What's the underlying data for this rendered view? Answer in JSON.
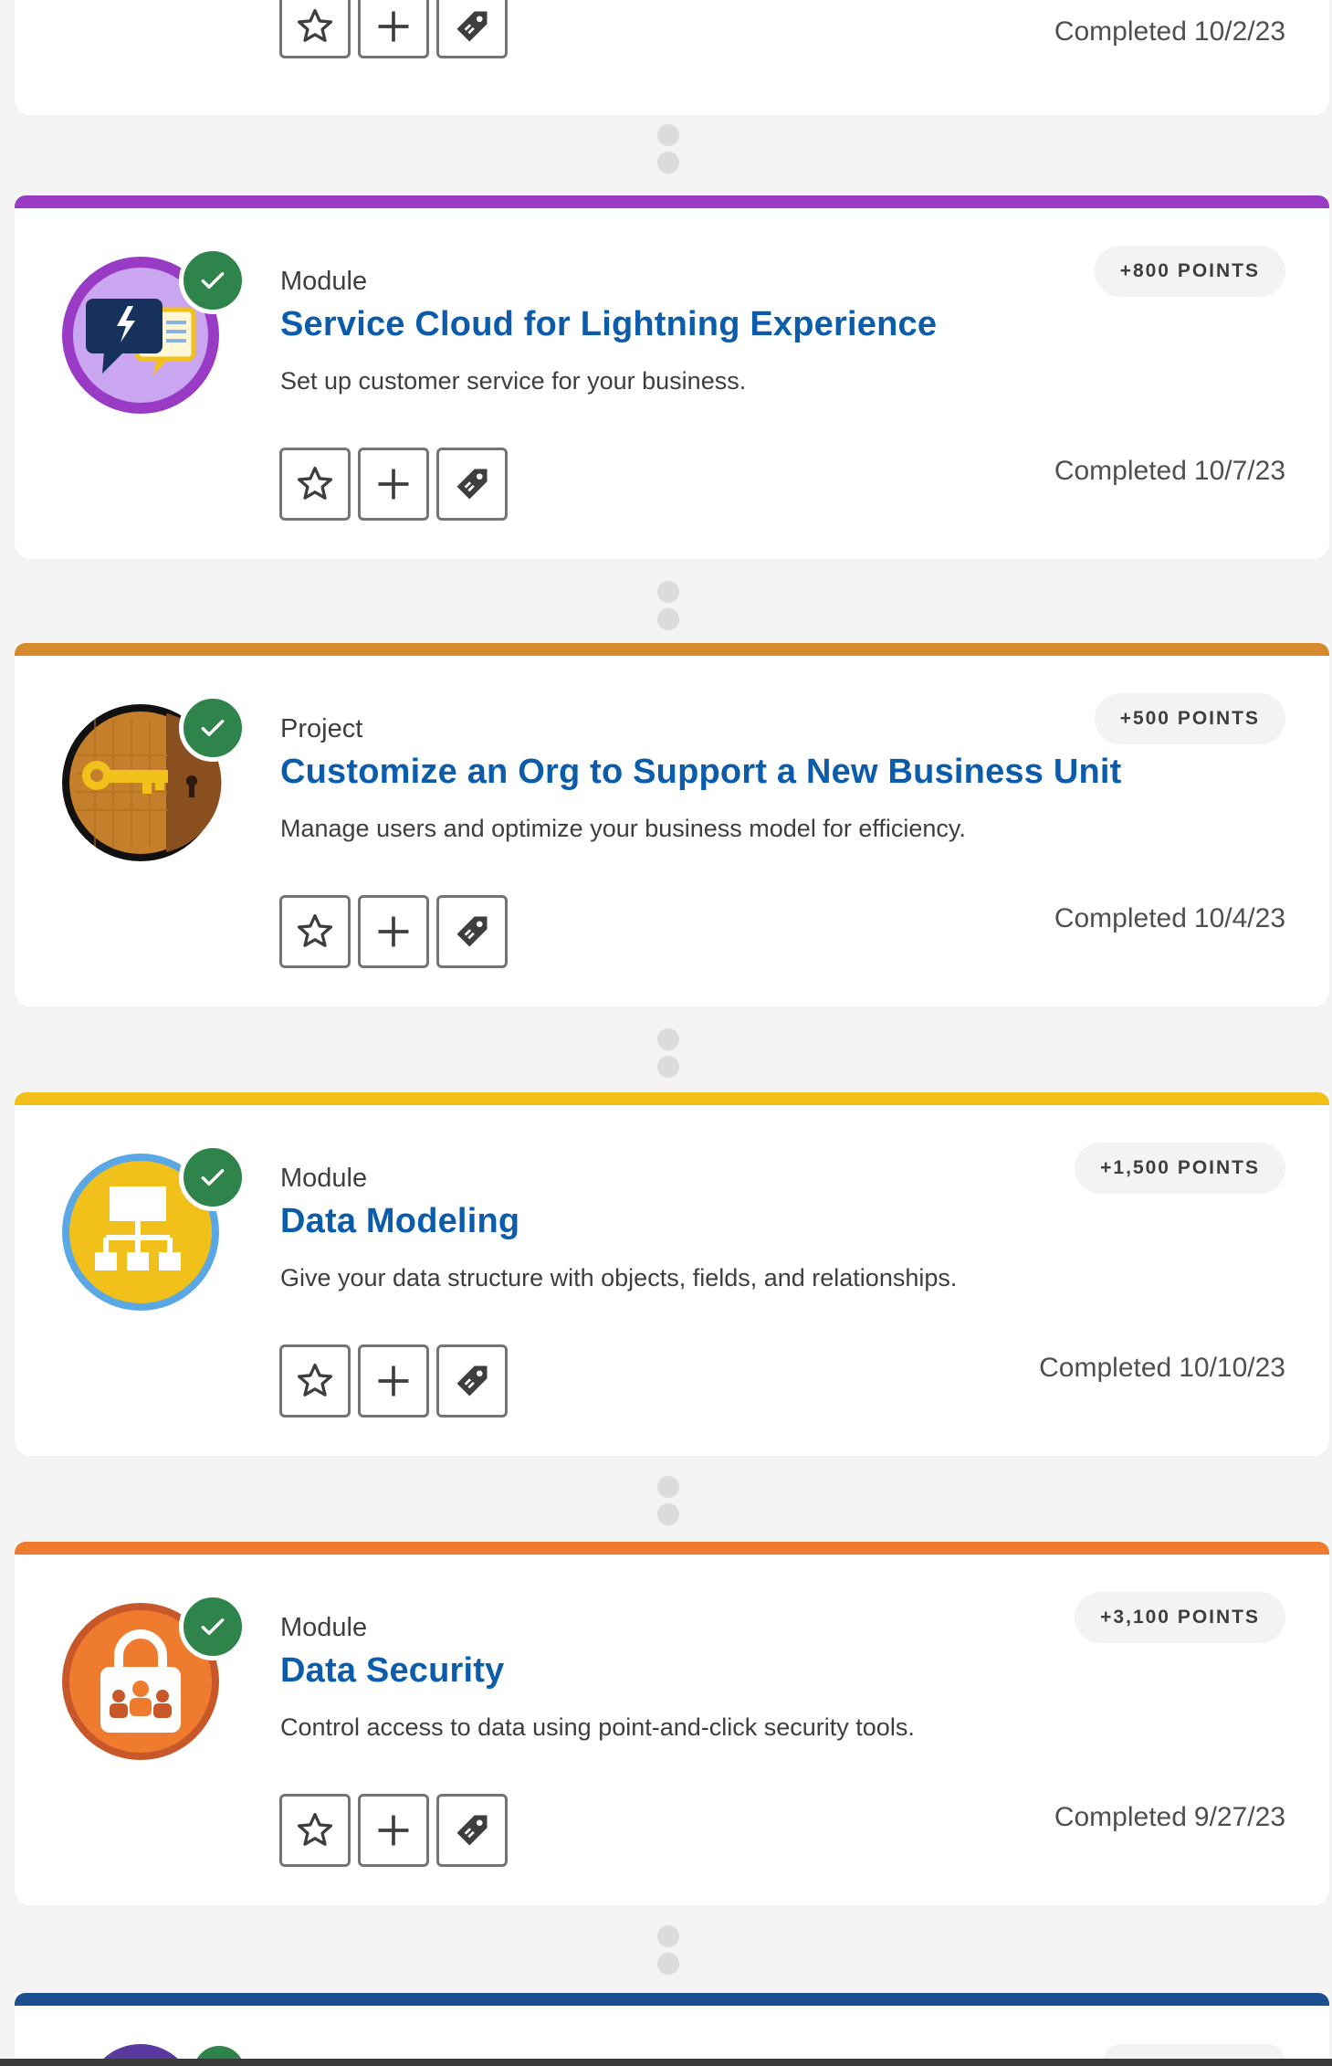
{
  "top_card": {
    "completed_label": "Completed",
    "completed_date": "10/2/23",
    "stripe_color": "#ffffff"
  },
  "cards": [
    {
      "type": "Module",
      "title": "Service Cloud for Lightning Experience",
      "description": "Set up customer service for your business.",
      "points": "+800 POINTS",
      "completed_label": "Completed",
      "completed_date": "10/7/23",
      "stripe_color": "#9a3bc6",
      "badge_icon": "service-cloud-chat-icon"
    },
    {
      "type": "Project",
      "title": "Customize an Org to Support a New Business Unit",
      "description": "Manage users and optimize your business model for efficiency.",
      "points": "+500 POINTS",
      "completed_label": "Completed",
      "completed_date": "10/4/23",
      "stripe_color": "#d68a2c",
      "badge_icon": "key-door-icon"
    },
    {
      "type": "Module",
      "title": "Data Modeling",
      "description": "Give your data structure with objects, fields, and relationships.",
      "points": "+1,500 POINTS",
      "completed_label": "Completed",
      "completed_date": "10/10/23",
      "stripe_color": "#f2c01a",
      "badge_icon": "hierarchy-icon"
    },
    {
      "type": "Module",
      "title": "Data Security",
      "description": "Control access to data using point-and-click security tools.",
      "points": "+3,100 POINTS",
      "completed_label": "Completed",
      "completed_date": "9/27/23",
      "stripe_color": "#ef7c2e",
      "badge_icon": "padlock-people-icon"
    }
  ],
  "bottom_card": {
    "stripe_color": "#1b4f8f"
  },
  "colors": {
    "title_link": "#0b5cab",
    "check_badge": "#2e844a",
    "page_background": "#f3f3f3"
  },
  "action_icons": [
    "star-icon",
    "plus-icon",
    "tag-icon"
  ]
}
